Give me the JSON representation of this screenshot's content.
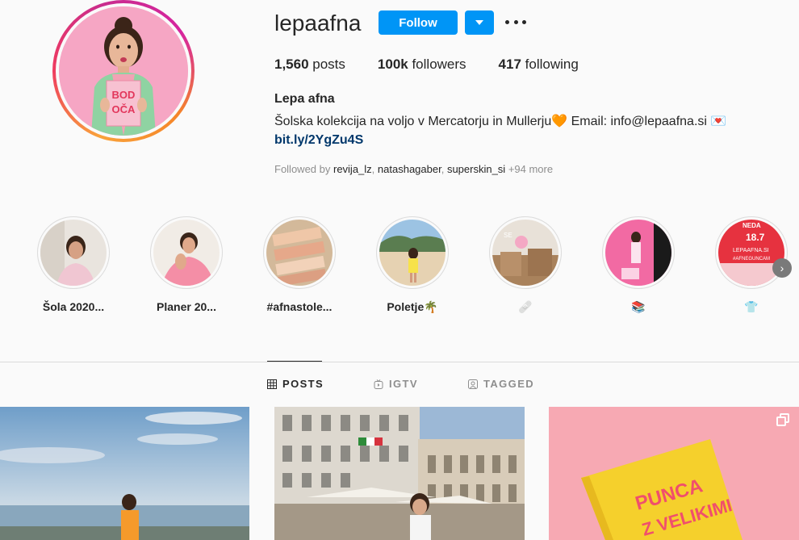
{
  "profile": {
    "username": "lepaafna",
    "follow_label": "Follow",
    "stats": {
      "posts_count": "1,560",
      "posts_label": " posts",
      "followers_count": "100k",
      "followers_label": " followers",
      "following_count": "417",
      "following_label": " following"
    },
    "full_name": "Lepa afna",
    "bio": "Šolska kolekcija na voljo v Mercatorju in Mullerju🧡 Email: info@lepaafna.si 💌",
    "link": "bit.ly/2YgZu4S",
    "followed_by_prefix": "Followed by ",
    "followed_by_users": [
      "revija_lz",
      "natashagaber",
      "superskin_si"
    ],
    "followed_by_more": " +94 more",
    "avatar_text": "BOD OČA"
  },
  "highlights": [
    {
      "label": "Šola 2020..."
    },
    {
      "label": "Planer 20..."
    },
    {
      "label": "#afnastole..."
    },
    {
      "label": "Poletje🌴"
    },
    {
      "label": "🩹"
    },
    {
      "label": "📚"
    },
    {
      "label": "👕"
    }
  ],
  "highlight_overlay_text": {
    "lepaafna": "LEPAAFNA.SI",
    "tag": "#AFNEGUNCAM",
    "num": "18.7",
    "top": "NEDA"
  },
  "tabs": [
    {
      "label": "POSTS",
      "active": true,
      "icon": "grid-icon"
    },
    {
      "label": "IGTV",
      "active": false,
      "icon": "igtv-icon"
    },
    {
      "label": "TAGGED",
      "active": false,
      "icon": "tagged-icon"
    }
  ],
  "posts": [
    {
      "icon": "none"
    },
    {
      "icon": "none"
    },
    {
      "icon": "multiple-images-icon",
      "book_text_1": "PUNCA",
      "book_text_2": "Z VELIKIMI"
    }
  ],
  "colors": {
    "accent": "#0095f6",
    "link": "#00376b",
    "text": "#262626",
    "muted": "#8e8e8e"
  }
}
